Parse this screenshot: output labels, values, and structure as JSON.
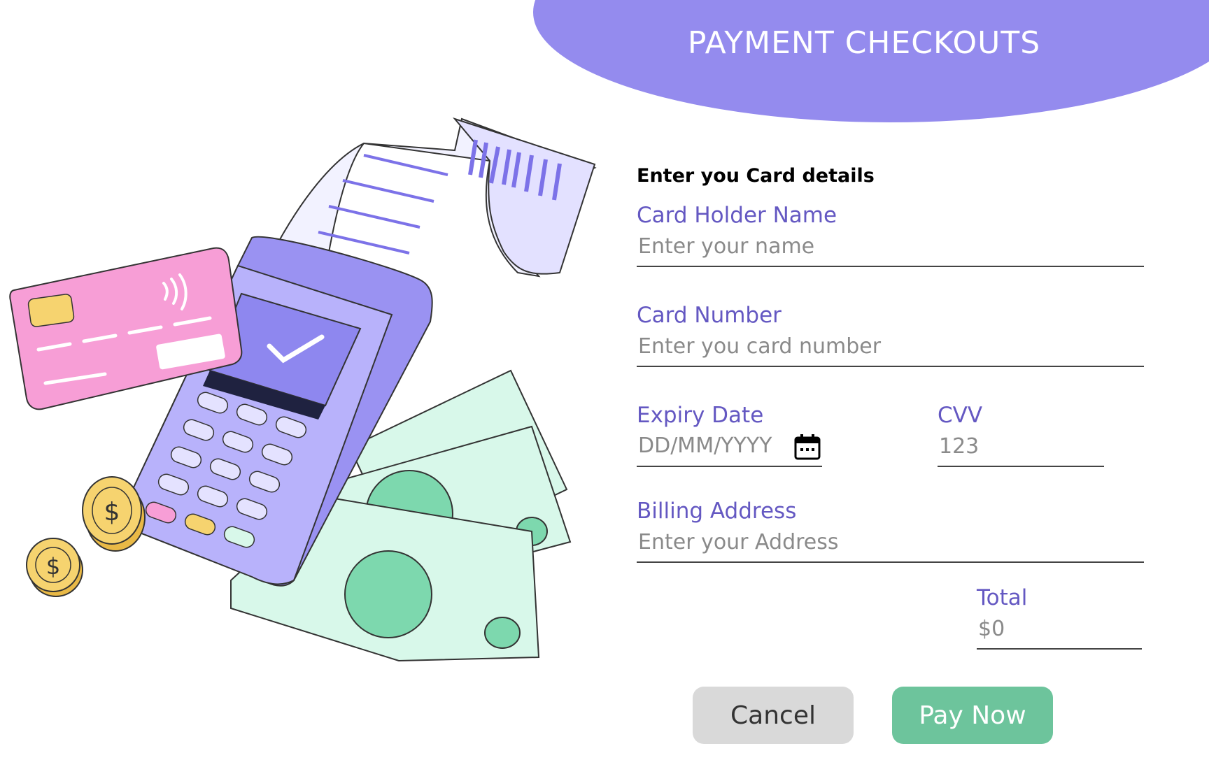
{
  "header": {
    "title": "PAYMENT CHECKOUTS"
  },
  "form": {
    "heading": "Enter you Card details",
    "card_holder": {
      "label": "Card Holder Name",
      "placeholder": "Enter your name",
      "value": ""
    },
    "card_number": {
      "label": "Card Number",
      "placeholder": "Enter you card number",
      "value": ""
    },
    "expiry": {
      "label": "Expiry Date",
      "placeholder": "DD/MM/YYYY",
      "value": "",
      "icon": "calendar-icon"
    },
    "cvv": {
      "label": "CVV",
      "placeholder": "123",
      "value": ""
    },
    "billing": {
      "label": "Billing Address",
      "placeholder": "Enter your Address",
      "value": ""
    },
    "total": {
      "label": "Total",
      "value": "$0"
    }
  },
  "buttons": {
    "cancel": "Cancel",
    "pay": "Pay Now"
  },
  "illustration": {
    "items": [
      "card-terminal",
      "receipt",
      "credit-card",
      "banknotes",
      "dollar-coins"
    ],
    "coin_symbol": "$"
  },
  "colors": {
    "accent": "#948bee",
    "label": "#6458c2",
    "pay_button": "#6dc49c",
    "cancel_button": "#d9d9d9",
    "credit_card": "#f79ed6",
    "money": "#d8f8ea",
    "coin": "#f6d36f"
  }
}
